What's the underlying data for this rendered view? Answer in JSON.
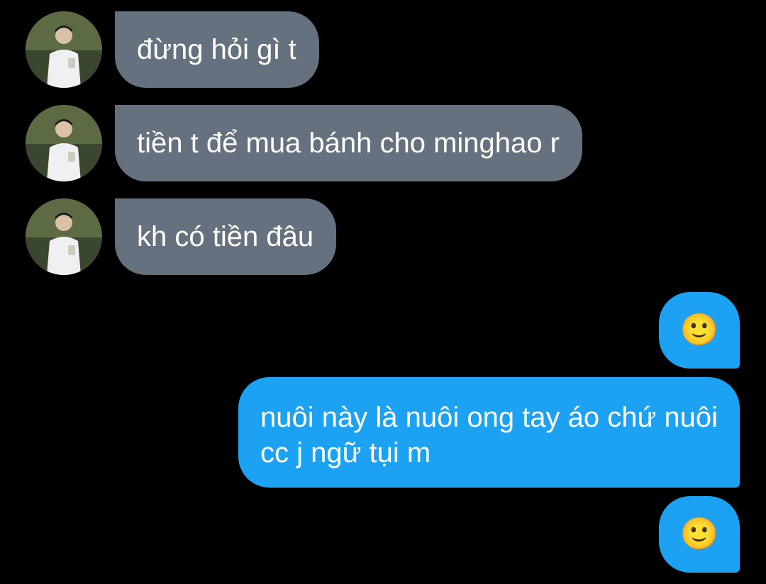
{
  "conversation": {
    "incoming": [
      {
        "text": "đừng hỏi gì t"
      },
      {
        "text": "tiền t để mua bánh cho minghao r"
      },
      {
        "text": "kh có tiền đâu"
      }
    ],
    "outgoing": [
      {
        "text": "🙂"
      },
      {
        "text": "nuôi này là nuôi ong tay áo chứ nuôi cc j ngữ tụi m"
      },
      {
        "text": "🙂"
      }
    ]
  },
  "colors": {
    "background": "#000000",
    "incoming_bubble": "#65717f",
    "outgoing_bubble": "#1da1f2",
    "text": "#ffffff"
  }
}
